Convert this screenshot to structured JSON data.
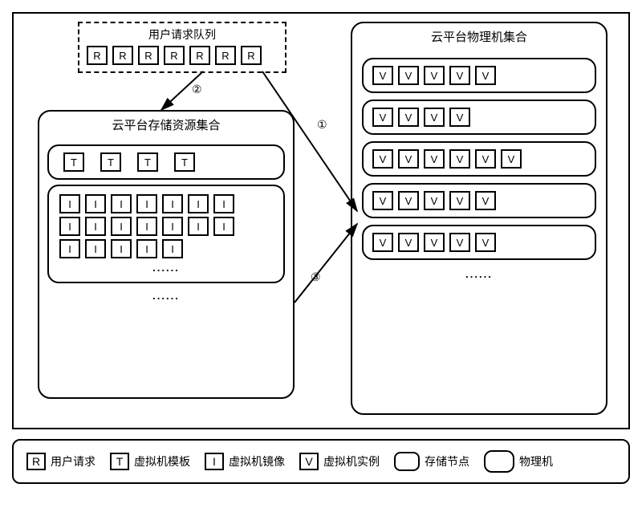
{
  "request_queue": {
    "title": "用户请求队列",
    "items": [
      "R",
      "R",
      "R",
      "R",
      "R",
      "R",
      "R"
    ]
  },
  "storage_panel": {
    "title": "云平台存储资源集合",
    "templates": [
      "T",
      "T",
      "T",
      "T"
    ],
    "images": {
      "rows": [
        [
          "I",
          "I",
          "I",
          "I",
          "I",
          "I",
          "I"
        ],
        [
          "I",
          "I",
          "I",
          "I",
          "I",
          "I",
          "I"
        ],
        [
          "I",
          "I",
          "I",
          "I",
          "I"
        ]
      ],
      "dots": "......"
    },
    "panel_dots": "......"
  },
  "physical_panel": {
    "title": "云平台物理机集合",
    "machines": [
      [
        "V",
        "V",
        "V",
        "V",
        "V"
      ],
      [
        "V",
        "V",
        "V",
        "V"
      ],
      [
        "V",
        "V",
        "V",
        "V",
        "V",
        "V"
      ],
      [
        "V",
        "V",
        "V",
        "V",
        "V"
      ],
      [
        "V",
        "V",
        "V",
        "V",
        "V"
      ]
    ],
    "panel_dots": "......"
  },
  "labels": {
    "arrow1": "①",
    "arrow2": "②",
    "arrow3": "③"
  },
  "legend": {
    "r": {
      "sym": "R",
      "text": "用户请求"
    },
    "t": {
      "sym": "T",
      "text": "虚拟机模板"
    },
    "i": {
      "sym": "I",
      "text": "虚拟机镜像"
    },
    "v": {
      "sym": "V",
      "text": "虚拟机实例"
    },
    "storage_node": "存储节点",
    "physical_machine": "物理机"
  }
}
